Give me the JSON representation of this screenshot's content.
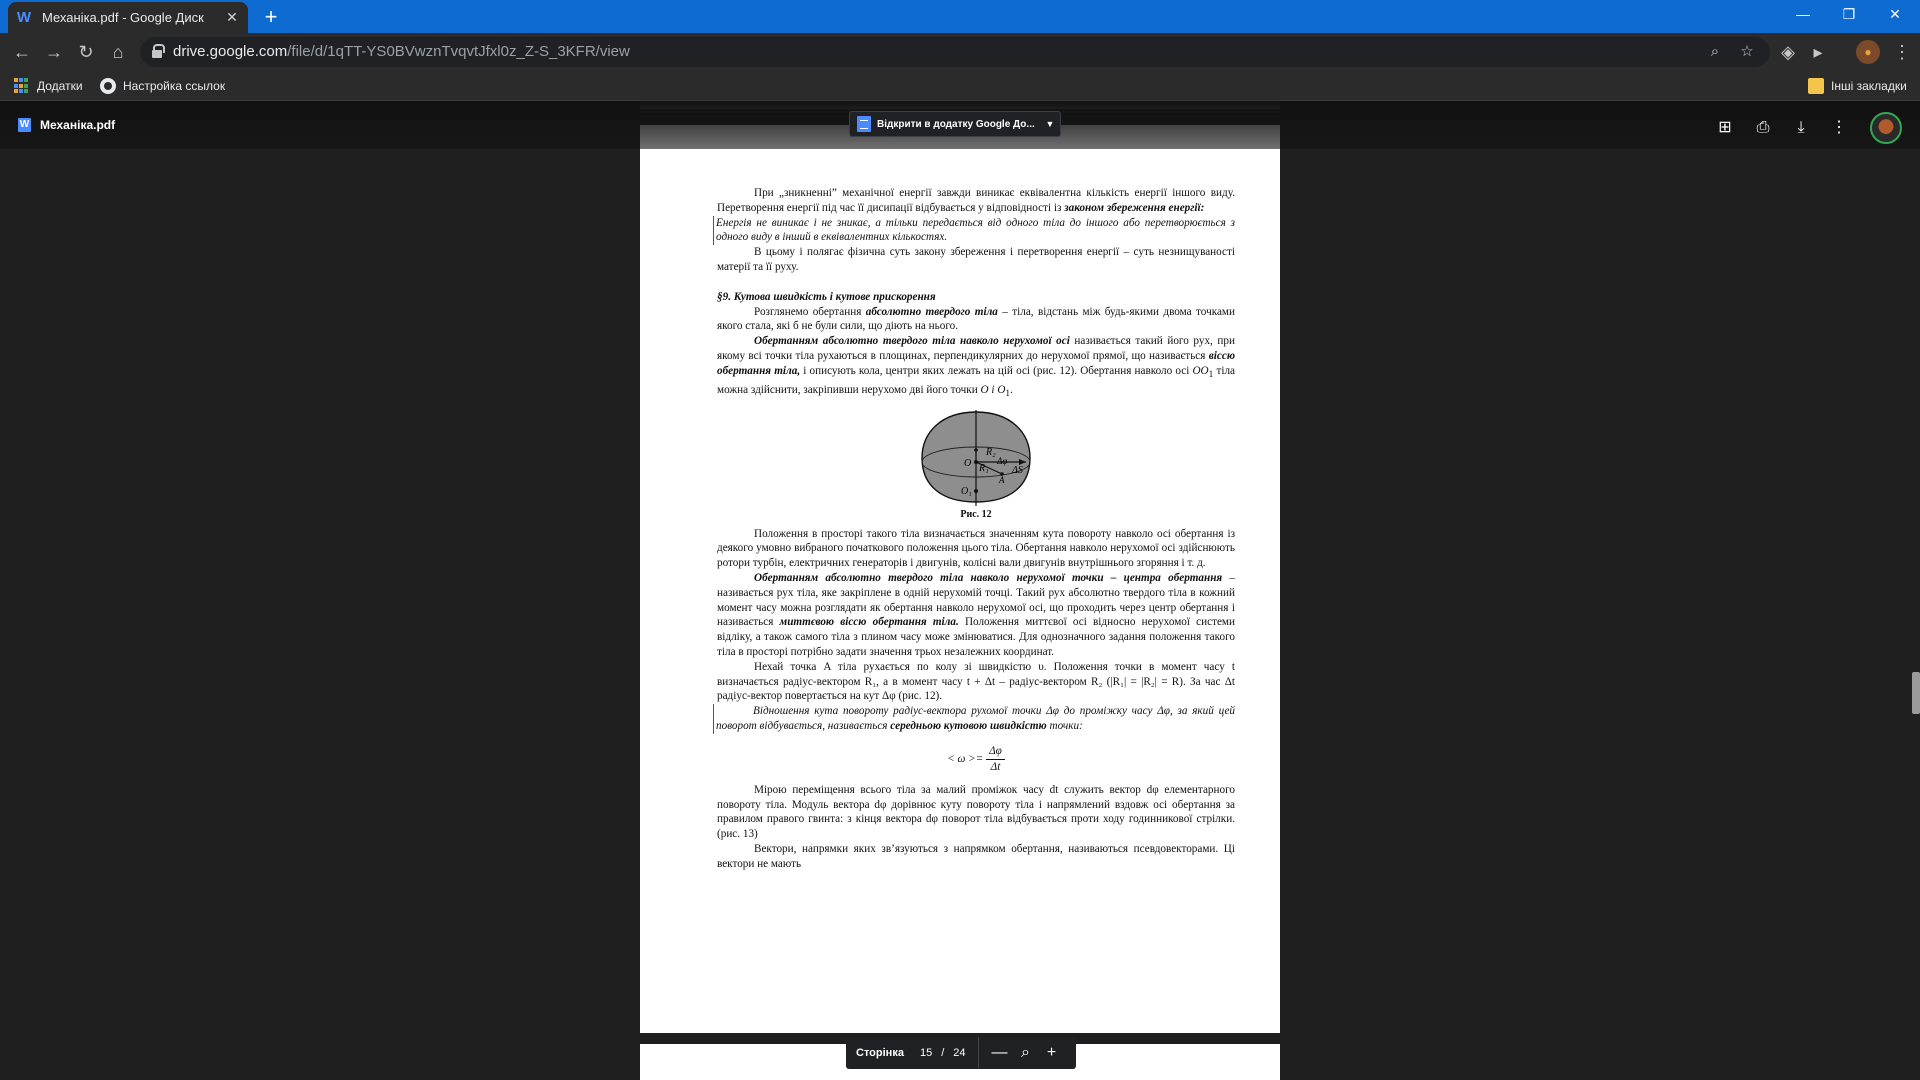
{
  "browser": {
    "tab": {
      "title": "Механіка.pdf - Google Диск",
      "favicon": "W"
    },
    "new_tab_label": "+",
    "window_controls": {
      "minimize": "—",
      "restore": "❐",
      "close": "✕"
    },
    "nav": {
      "back": "←",
      "forward": "→",
      "reload": "↻",
      "home": "⌂"
    },
    "url": {
      "host": "drive.google.com",
      "path": "/file/d/1qTT-YS0BVwznTvqvtJfxl0z_Z-S_3KFR/view"
    },
    "omnibox_icons": {
      "zoom": "⌕",
      "star": "☆",
      "ext1": "◈",
      "ext2": "▸",
      "menu": "⋮"
    },
    "bookmarks": [
      {
        "label": "Додатки",
        "icon": "apps-icon"
      },
      {
        "label": "Настройка ссылок",
        "icon": "globe-icon"
      }
    ],
    "other_bookmarks": "Інші закладки"
  },
  "viewer": {
    "doc_title": "Механіка.pdf",
    "doc_icon": "W",
    "open_with": "Відкрити в додатку Google До...",
    "header_icons": {
      "add_to_drive": "⊞",
      "print": "⎙",
      "download": "⤓",
      "more": "⋮"
    },
    "page_indicator": {
      "label": "Сторінка",
      "current": "15",
      "separator": "/",
      "total": "24"
    },
    "zoom": {
      "out": "—",
      "icon": "⌕",
      "in": "+"
    }
  },
  "page": {
    "p1": "При „зникненні” механічної енергії завжди виникає еквівалентна кількість енергії іншого виду. Перетворення енергії під час її дисипації відбувається у відповідності із ",
    "p1_bold": "законом збереження енергії:",
    "quote": "Енергія не виникає і не зникає, а тільки передається від одного тіла до іншого або перетворюється з одного виду в інший в еквівалентних кількостях.",
    "p2": "В цьому і полягає фізична суть закону збереження і перетворення енергії – суть незнищуваності матерії та її руху.",
    "heading": "§9. Кутова швидкість і кутове прискорення",
    "p3a": "Розглянемо обертання ",
    "p3b": "абсолютно твердого тіла",
    "p3c": " – тіла, відстань між будь-якими двома точками якого стала, які б не були сили, що діють на нього.",
    "p4a": "Обертанням абсолютно твердого тіла навколо нерухомої осі",
    "p4b": " називається такий його рух, при якому всі точки тіла рухаються в площинах, перпендикулярних до нерухомої прямої, що називається ",
    "p4c": "віссю обертання тіла,",
    "p4d": " і описують кола, центри яких лежать на цій осі (рис. 12). Обертання навколо осі ",
    "p4e": "OO",
    "p4f": " тіла можна здійснити, закріпивши нерухомо дві його точки ",
    "p4g": "O і O",
    "figure_caption": "Рис. 12",
    "figure_labels": {
      "R2": "R₂",
      "O": "O",
      "R1": "R₁",
      "dphi": "Δφ",
      "A": "A",
      "dS": "ΔS",
      "O1": "O₁"
    },
    "p5": "Положення в просторі такого тіла визначається значенням кута повороту навколо осі обертання із деякого умовно вибраного початкового положення цього тіла. Обертання навколо нерухомої осі здійснюють ротори турбін, електричних генераторів і двигунів, колісні вали двигунів внутрішнього згоряння і т. д.",
    "p6a": "Обертанням абсолютно твердого тіла навколо нерухомої точки – центра обертання",
    "p6b": " – називається рух тіла, яке закріплене в одній нерухомій точці. Такий рух абсолютно твердого тіла в кожний момент часу можна розглядати як обертання навколо нерухомої осі, що проходить через центр обертання і називається ",
    "p6c": "миттєвою віссю обертання тіла.",
    "p6d": " Положення миттєвої осі відносно нерухомої системи відліку, а також самого тіла з плином часу може змінюватися. Для однозначного задання положення такого тіла в просторі потрібно задати значення трьох незалежних координат.",
    "p7": "Нехай точка A тіла рухається по колу зі швидкістю υ. Положення точки в момент часу t визначається радіус-вектором R₁, а в момент часу t + Δt – радіус-вектором R₂ (|R₁| = |R₂| = R). За час Δt радіус-вектор повертається на кут Δφ (рис. 12).",
    "quote2a": "Відношення кута повороту радіус-вектора рухомої точки Δφ до проміжку часу Δφ, за який цей поворот відбувається, називається ",
    "quote2b": "середньою кутовою швидкістю",
    "quote2c": " точки:",
    "formula_lhs": "< ω >=",
    "formula_num": "Δφ",
    "formula_den": "Δt",
    "p8": "Мірою переміщення всього тіла за малий проміжок часу dt служить вектор dφ елементарного повороту тіла. Модуль вектора dφ дорівнює куту повороту тіла і напрямлений вздовж осі обертання за правилом правого гвинта: з кінця вектора dφ поворот тіла відбувається проти ходу годинникової стрілки.(рис. 13)",
    "p9": "Вектори, напрямки яких зв’язуються з напрямком обертання, називаються псевдовекторами. Ці вектори не мають"
  },
  "colors": {
    "titlebar": "#0e6bd1",
    "toolbar": "#2b2b2b",
    "viewer_bg": "#1f1f1f",
    "accent": "#4a8cff"
  }
}
